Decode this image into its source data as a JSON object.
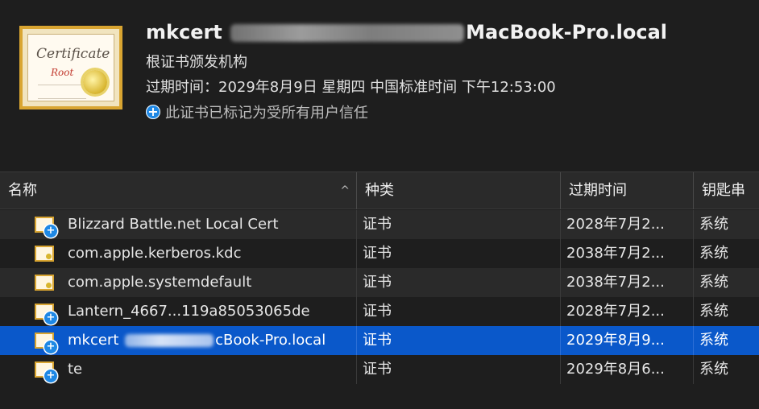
{
  "header": {
    "icon_line1": "Certificate",
    "icon_line2": "Root",
    "title_prefix": "mkcert",
    "title_suffix": "MacBook-Pro.local",
    "subtitle": "根证书颁发机构",
    "expiry": "过期时间：2029年8月9日 星期四 中国标准时间 下午12:53:00",
    "trust_text": "此证书已标记为受所有用户信任",
    "trust_badge": "+"
  },
  "columns": {
    "name": "名称",
    "kind": "种类",
    "expires": "过期时间",
    "keychain": "钥匙串",
    "sort_indicator": "^"
  },
  "rows": [
    {
      "name": "Blizzard Battle.net Local Cert",
      "kind": "证书",
      "expires": "2028年7月2...",
      "keychain": "系统",
      "trusted": true
    },
    {
      "name": "com.apple.kerberos.kdc",
      "kind": "证书",
      "expires": "2038年7月2...",
      "keychain": "系统",
      "trusted": false
    },
    {
      "name": "com.apple.systemdefault",
      "kind": "证书",
      "expires": "2038年7月2...",
      "keychain": "系统",
      "trusted": false
    },
    {
      "name": "Lantern_4667...119a85053065de",
      "kind": "证书",
      "expires": "2028年7月2...",
      "keychain": "系统",
      "trusted": true
    },
    {
      "name_prefix": "mkcert",
      "name_suffix": "cBook-Pro.local",
      "kind": "证书",
      "expires": "2029年8月9...",
      "keychain": "系统",
      "trusted": true,
      "selected": true
    },
    {
      "name": "te",
      "kind": "证书",
      "expires": "2029年8月6...",
      "keychain": "系统",
      "trusted": true
    }
  ],
  "colors": {
    "selection": "#0a58ca",
    "badge": "#1e88e5",
    "background": "#1e1e1e"
  }
}
